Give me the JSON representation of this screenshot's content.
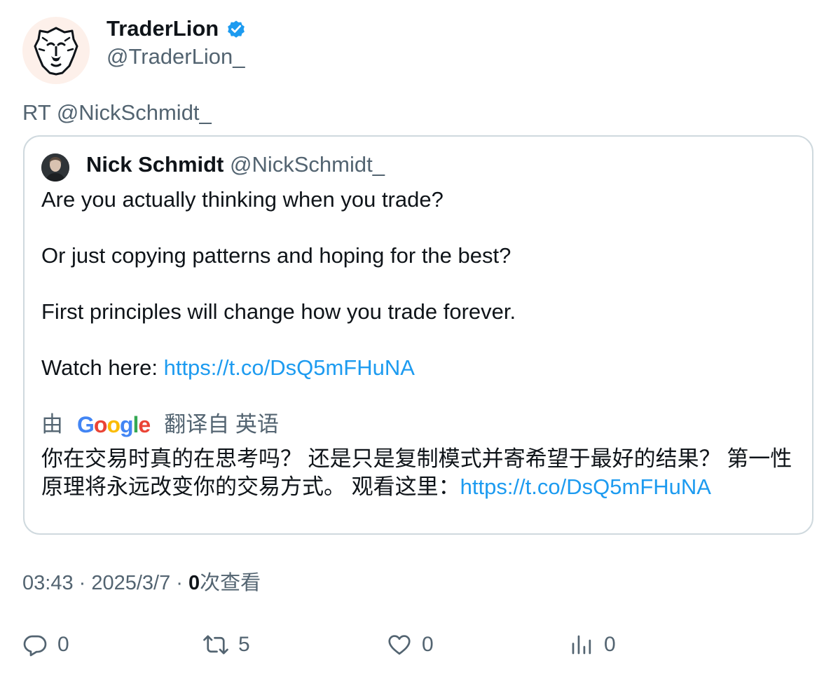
{
  "author": {
    "display_name": "TraderLion",
    "handle": "@TraderLion_",
    "verified_icon": "verified-badge-icon",
    "avatar_icon": "lion-logo-icon"
  },
  "retweet_line": "RT @NickSchmidt_",
  "quoted": {
    "display_name": "Nick Schmidt",
    "handle": "@NickSchmidt_",
    "lines": {
      "l1": "Are you actually thinking when you trade?",
      "l2": "Or just copying patterns and hoping for the best?",
      "l3": "First principles will change how you trade forever.",
      "l4_prefix": "Watch here: ",
      "l4_link": "https://t.co/DsQ5mFHuNA"
    },
    "translation": {
      "prefix": "由",
      "provider": "Google",
      "suffix": "翻译自 英语",
      "text": "你在交易时真的在思考吗？ 还是只是复制模式并寄希望于最好的结果？ 第一性原理将永远改变你的交易方式。 观看这里：",
      "link": "https://t.co/DsQ5mFHuNA"
    }
  },
  "meta": {
    "time": "03:43",
    "sep1": " · ",
    "date": "2025/3/7",
    "sep2": " · ",
    "views_count": "0",
    "views_label": "次查看"
  },
  "actions": {
    "replies": "0",
    "retweets": "5",
    "likes": "0",
    "views": "0"
  },
  "colors": {
    "link": "#1d9bf0",
    "secondary_text": "#536471",
    "border": "#cfd9de"
  }
}
